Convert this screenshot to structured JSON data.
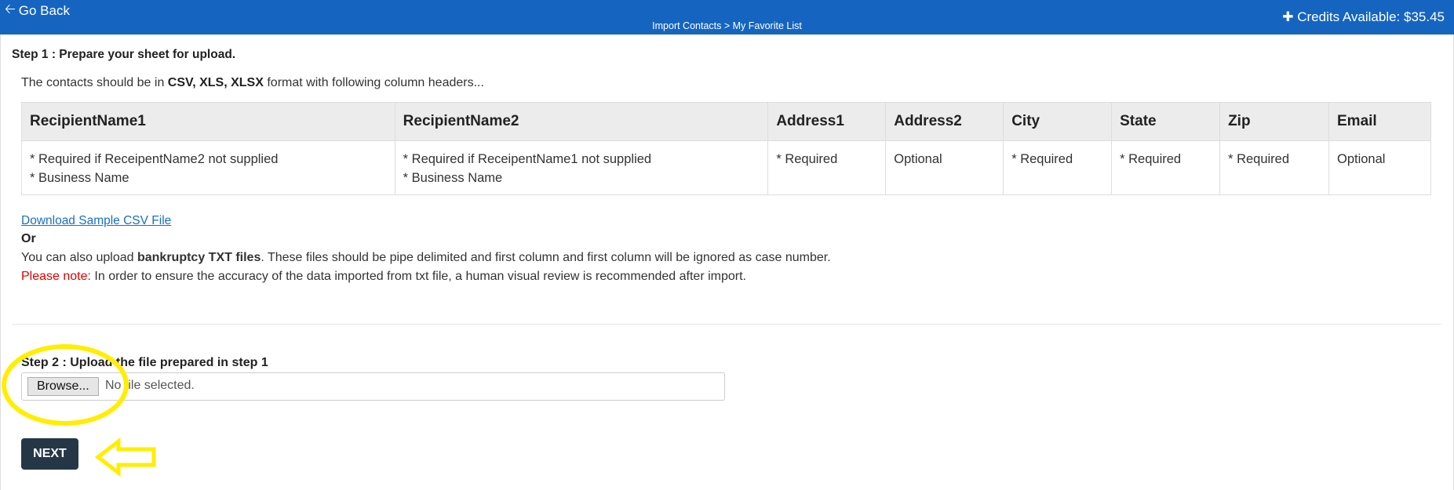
{
  "header": {
    "go_back_label": "Go Back",
    "breadcrumb": "Import Contacts > My Favorite List",
    "credits_label": "Credits Available: $35.45"
  },
  "step1": {
    "title": "Step 1 : Prepare your sheet for upload.",
    "intro_prefix": "The contacts should be in ",
    "formats": "CSV, XLS, XLSX",
    "intro_suffix": " format with following column headers...",
    "columns": [
      {
        "header": "RecipientName1",
        "line1": "* Required if ReceipentName2 not supplied",
        "line2": "* Business Name"
      },
      {
        "header": "RecipientName2",
        "line1": "* Required if ReceipentName1 not supplied",
        "line2": "* Business Name"
      },
      {
        "header": "Address1",
        "line1": "* Required",
        "line2": ""
      },
      {
        "header": "Address2",
        "line1": "Optional",
        "line2": ""
      },
      {
        "header": "City",
        "line1": "* Required",
        "line2": ""
      },
      {
        "header": "State",
        "line1": "* Required",
        "line2": ""
      },
      {
        "header": "Zip",
        "line1": "* Required",
        "line2": ""
      },
      {
        "header": "Email",
        "line1": "Optional",
        "line2": ""
      }
    ],
    "download_link": "Download Sample CSV File",
    "or_label": "Or",
    "txt_prefix": "You can also upload ",
    "txt_bold": "bankruptcy TXT files",
    "txt_suffix": ". These files should be pipe delimited and first column and first column will be ignored as case number.",
    "note_label": "Please note:",
    "note_text": " In order to ensure the accuracy of the data imported from txt file, a human visual review is recommended after import."
  },
  "step2": {
    "title": "Step 2 : Upload the file prepared in step 1",
    "browse_label": "Browse...",
    "file_status": "No file selected."
  },
  "actions": {
    "next_label": "NEXT"
  },
  "colors": {
    "header_bg": "#1565c0",
    "next_bg": "#253746",
    "annotation": "#ffee00",
    "note_red": "#e00000",
    "link": "#1a6fc4"
  }
}
